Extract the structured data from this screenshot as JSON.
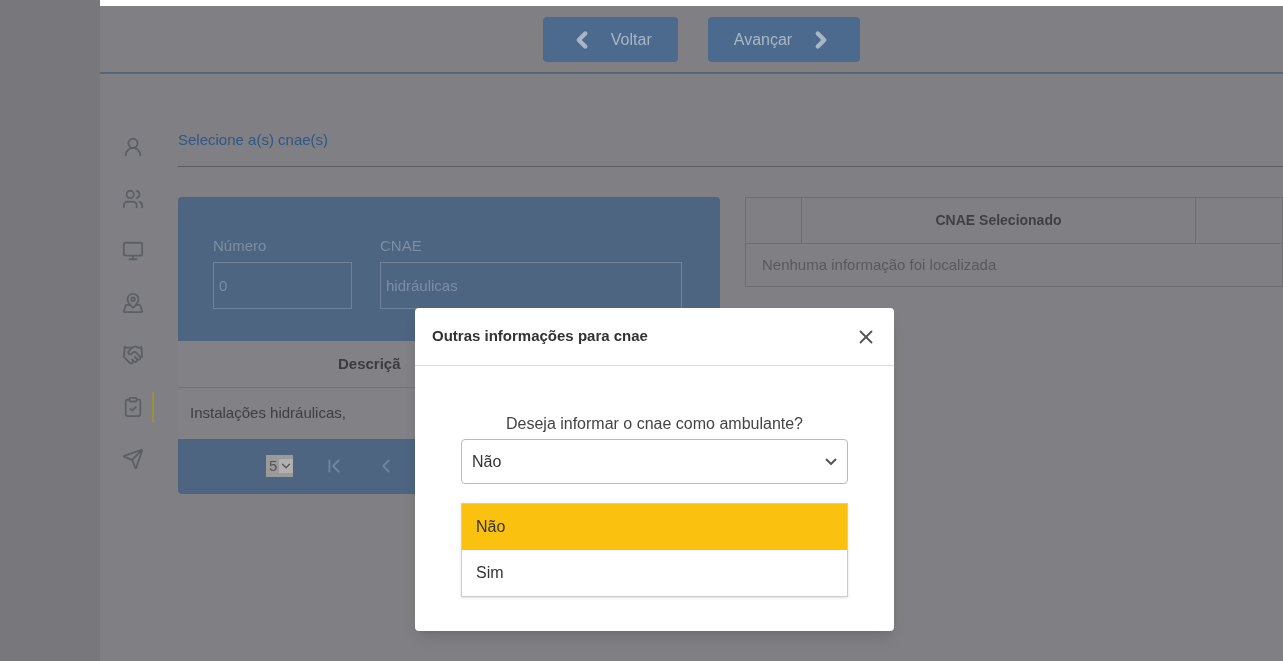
{
  "nav": {
    "buttons": [
      {
        "label": "Voltar",
        "kind": "back"
      },
      {
        "label": "Avançar",
        "kind": "next"
      }
    ]
  },
  "sidebar": {
    "items": [
      {
        "kind": "person",
        "selected": false
      },
      {
        "kind": "people",
        "selected": false
      },
      {
        "kind": "computer",
        "selected": false
      },
      {
        "kind": "map",
        "selected": false
      },
      {
        "kind": "handshake",
        "selected": false
      },
      {
        "kind": "clipboard",
        "selected": true
      },
      {
        "kind": "send",
        "selected": false
      }
    ]
  },
  "section_title": "Selecione a(s) cnae(s)",
  "search_form": {
    "fields": [
      {
        "label": "Número",
        "value": "0"
      },
      {
        "label": "CNAE",
        "value": "hidráulicas"
      }
    ]
  },
  "results_table": {
    "columns": [
      "Descriçã"
    ],
    "rows": [
      [
        "Instalações hidráulicas,"
      ]
    ],
    "page_size": "5"
  },
  "selected_table": {
    "columns": [
      "CNAE Selecionado"
    ],
    "empty_message": "Nenhuma informação foi localizada"
  },
  "modal": {
    "title": "Outras informações para cnae",
    "question": "Deseja informar o cnae como ambulante?",
    "select": {
      "value": "Não",
      "expanded": true,
      "options": [
        {
          "label": "Não",
          "selected": true
        },
        {
          "label": "Sim",
          "selected": false
        }
      ]
    }
  }
}
